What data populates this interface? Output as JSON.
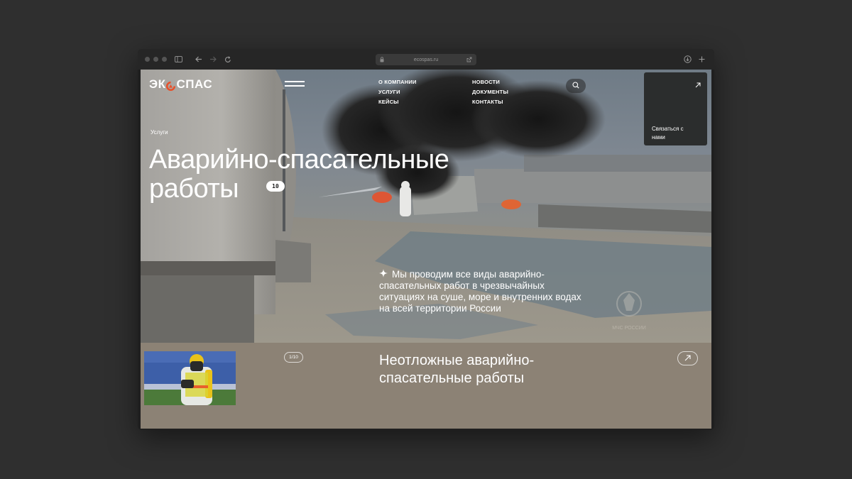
{
  "browser": {
    "url": "ecospas.ru"
  },
  "header": {
    "logo_text_left": "ЭК",
    "logo_text_right": "СПАС",
    "nav_col1": [
      "О КОМПАНИИ",
      "УСЛУГИ",
      "КЕЙСЫ"
    ],
    "nav_col2": [
      "НОВОСТИ",
      "ДОКУМЕНТЫ",
      "КОНТАКТЫ"
    ],
    "contact_label": "Связаться с нами"
  },
  "hero": {
    "breadcrumb": "Услуги",
    "title_line1": "Аварийно-спасательные",
    "title_line2": "работы",
    "count_badge": "10",
    "description": "Мы проводим все виды аварийно-спасательных работ в чрезвычайных ситуациях на суше, море и внутренних водах на всей территории России",
    "watermark": "МЧС РОССИИ"
  },
  "services": {
    "pager": "1/10",
    "current_title": "Неотложные аварийно-спасательные работы"
  },
  "colors": {
    "accent": "#e8502a",
    "bottom_panel": "#8c8275",
    "contact_panel": "#2b2d2d"
  },
  "icons": [
    "sidebar-icon",
    "back-arrow-icon",
    "forward-arrow-icon",
    "reload-icon",
    "lock-icon",
    "share-icon",
    "download-icon",
    "plus-icon",
    "menu-icon",
    "search-icon",
    "arrow-up-right-icon",
    "sparkle-icon"
  ]
}
